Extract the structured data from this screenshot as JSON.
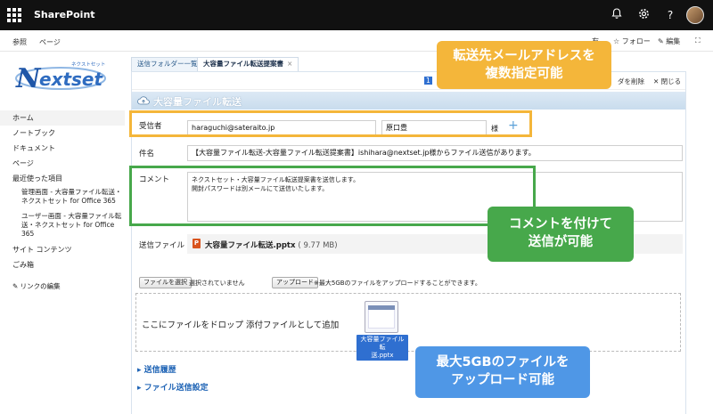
{
  "suite": {
    "app_name": "SharePoint",
    "icons": [
      "waffle-icon",
      "bell-icon",
      "gear-icon",
      "help-icon",
      "avatar"
    ]
  },
  "ribbon": {
    "tabs": [
      "参照",
      "ページ"
    ],
    "follow": "フォロー",
    "edit": "編集",
    "share_partial": "有"
  },
  "logo": {
    "text": "Nextset",
    "subtext": "ネクストセット"
  },
  "leftnav": {
    "items": [
      {
        "label": "ホーム",
        "active": true
      },
      {
        "label": "ノートブック"
      },
      {
        "label": "ドキュメント"
      },
      {
        "label": "ページ"
      },
      {
        "label": "最近使った項目"
      }
    ],
    "recent": [
      "管理画面 - 大容量ファイル転送・ネクストセット for Office 365",
      "ユーザー画面 - 大容量ファイル転送・ネクストセット for Office 365"
    ],
    "bottom": [
      "サイト コンテンツ",
      "ごみ箱"
    ],
    "edit_links": "リンクの編集"
  },
  "tabs": [
    {
      "label": "送信フォルダー一覧"
    },
    {
      "label": "大容量ファイル転送提案書",
      "close": "×"
    }
  ],
  "toolbar": {
    "delete_partial": "ダを削除",
    "close": "閉じる",
    "badge": "1"
  },
  "form": {
    "title": "大容量ファイル転送",
    "recipient_label": "受信者",
    "recipient_email": "haraguchi@sateraito.jp",
    "recipient_name": "原口豊",
    "honorific": "様",
    "add": "+",
    "subject_label": "件名",
    "subject_value": "【大容量ファイル転送-大容量ファイル転送提案書】ishihara@nextset.jp様からファイル送信があります。",
    "comment_label": "コメント",
    "comment_line1": "ネクストセット・大容量ファイル転送提案書を送信します。",
    "comment_line2": "開封パスワードは別メールにて送信いたします。",
    "file_label": "送信ファイル",
    "file_icon": "P",
    "file_name": "大容量ファイル転送.pptx",
    "file_size": "( 9.77 MB)",
    "choose_file": "ファイルを選択",
    "no_file": "選択されていません",
    "upload": "アップロード",
    "upload_note": "※最大5GBのファイルをアップロードすることができます。",
    "drop_text": "ここにファイルをドロップ 添付ファイルとして追加",
    "thumb_caption_1": "大容量ファイル転",
    "thumb_caption_2": "送.pptx",
    "history": "▸ 送信履歴",
    "settings": "▸ ファイル送信設定"
  },
  "callouts": {
    "orange_1": "転送先メールアドレスを",
    "orange_2": "複数指定可能",
    "green_1": "コメントを付けて",
    "green_2": "送信が可能",
    "blue_1": "最大5GBのファイルを",
    "blue_2": "アップロード可能"
  },
  "colors": {
    "suite_bg": "#111111",
    "accent_blue": "#1e63b5",
    "callout_orange": "#f4b63a",
    "callout_green": "#47a84b",
    "callout_blue": "#4f97e6"
  }
}
